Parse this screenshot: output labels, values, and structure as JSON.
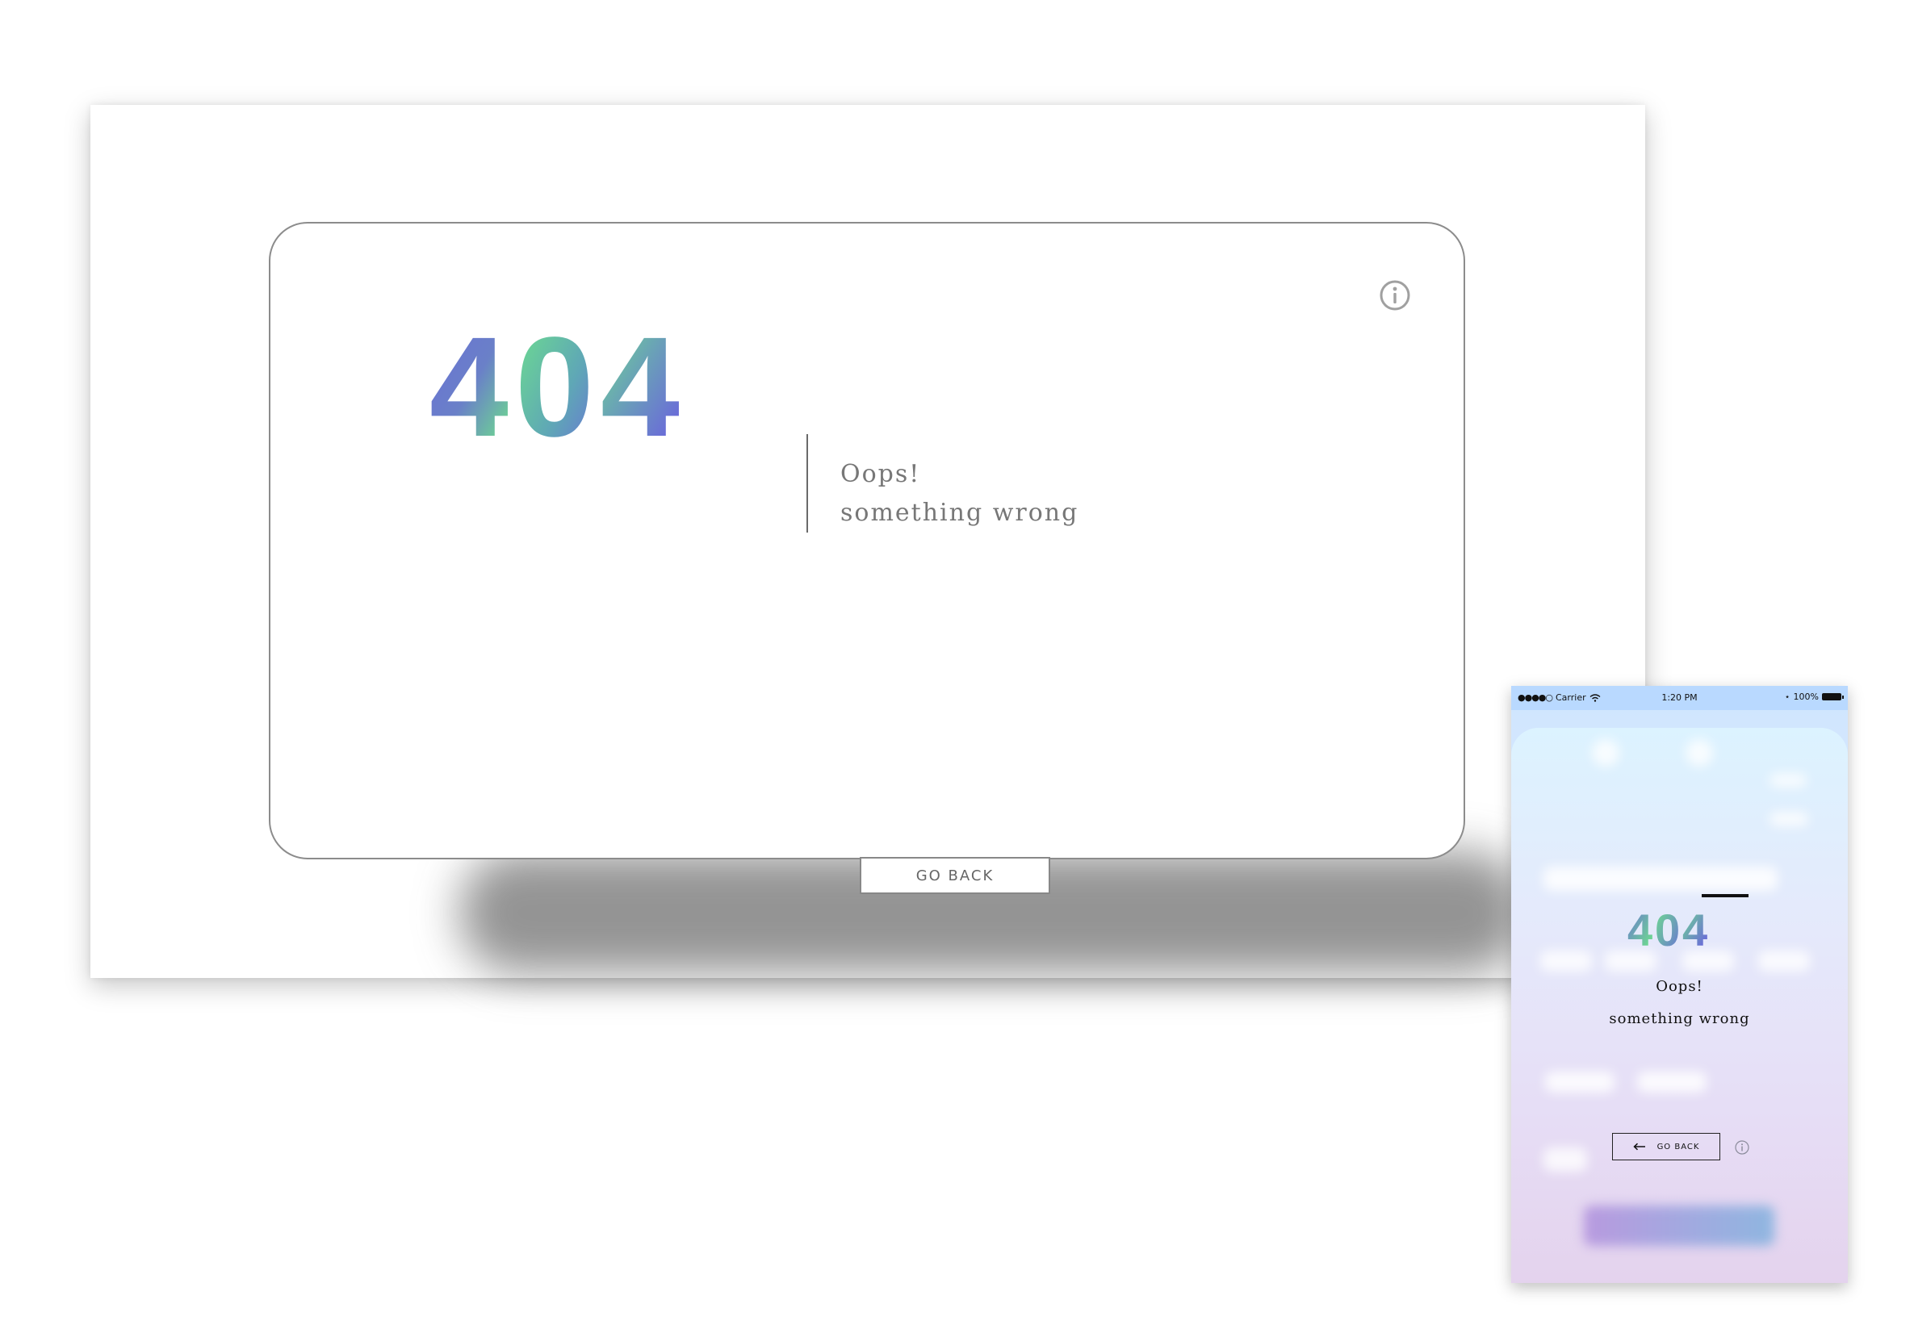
{
  "desktop": {
    "error_code": "404",
    "headline": "Oops!",
    "subline": "something wrong",
    "go_back_label": "GO BACK",
    "info_icon": "info-circle-icon"
  },
  "mobile": {
    "status_bar": {
      "carrier": "Carrier",
      "time": "1:20 PM",
      "battery": "100%"
    },
    "error_code": "404",
    "headline": "Oops!",
    "subline": "something wrong",
    "go_back_label": "GO BACK",
    "back_icon": "arrow-left-icon",
    "info_icon": "info-circle-icon"
  },
  "colors": {
    "gradient_blue": "#6a6fd8",
    "gradient_green": "#6ee38a",
    "text_gray": "#777777",
    "border_gray": "#8c8c8c"
  }
}
